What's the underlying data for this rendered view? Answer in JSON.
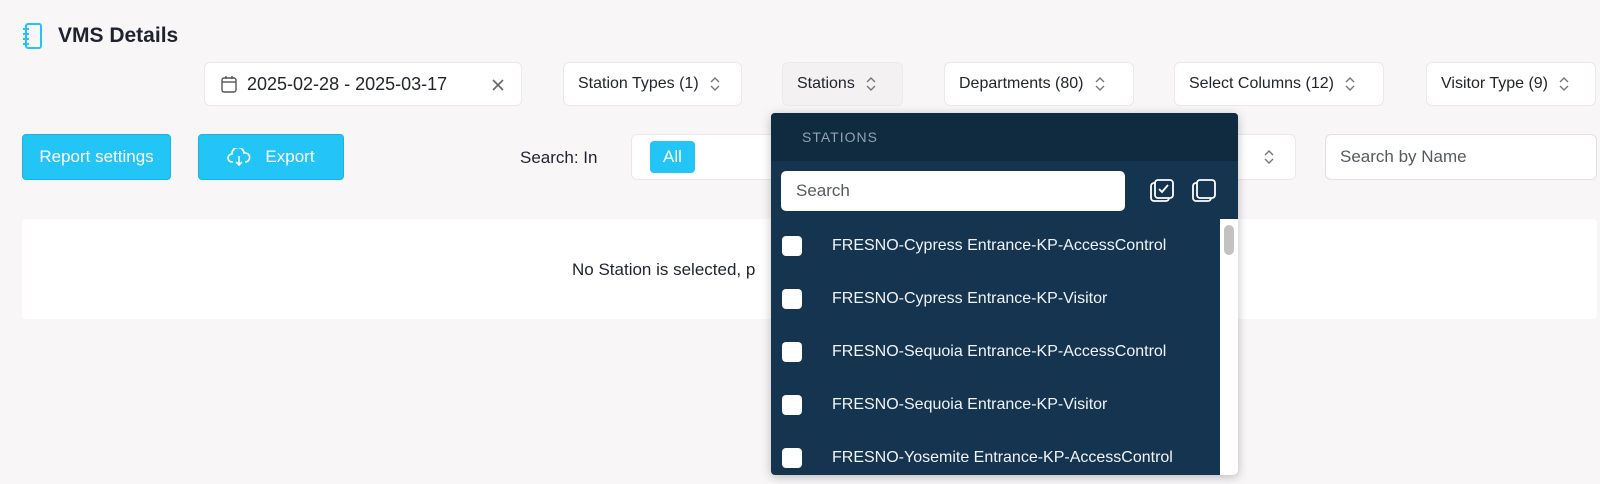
{
  "header": {
    "title": "VMS Details",
    "icon": "notebook-icon"
  },
  "filters": {
    "date_range": "2025-02-28 - 2025-03-17",
    "station_types": "Station Types (1)",
    "stations": "Stations",
    "departments": "Departments (80)",
    "select_columns": "Select Columns (12)",
    "visitor_type": "Visitor Type (9)"
  },
  "actions": {
    "report_settings": "Report settings",
    "export": "Export"
  },
  "search": {
    "label": "Search: In",
    "scope_tag": "All",
    "name_placeholder": "Search by Name"
  },
  "empty_state": {
    "message": "No Station is selected, p"
  },
  "stations_dropdown": {
    "title": "STATIONS",
    "search_placeholder": "Search",
    "items": [
      {
        "label": "FRESNO-Cypress Entrance-KP-AccessControl",
        "checked": false
      },
      {
        "label": "FRESNO-Cypress Entrance-KP-Visitor",
        "checked": false
      },
      {
        "label": "FRESNO-Sequoia Entrance-KP-AccessControl",
        "checked": false
      },
      {
        "label": "FRESNO-Sequoia Entrance-KP-Visitor",
        "checked": false
      },
      {
        "label": "FRESNO-Yosemite Entrance-KP-AccessControl",
        "checked": false
      }
    ]
  },
  "colors": {
    "accent": "#22c5f5",
    "dropdown_bg": "#14344f",
    "dropdown_header": "#102a40",
    "page_bg": "#f8f6f7"
  }
}
